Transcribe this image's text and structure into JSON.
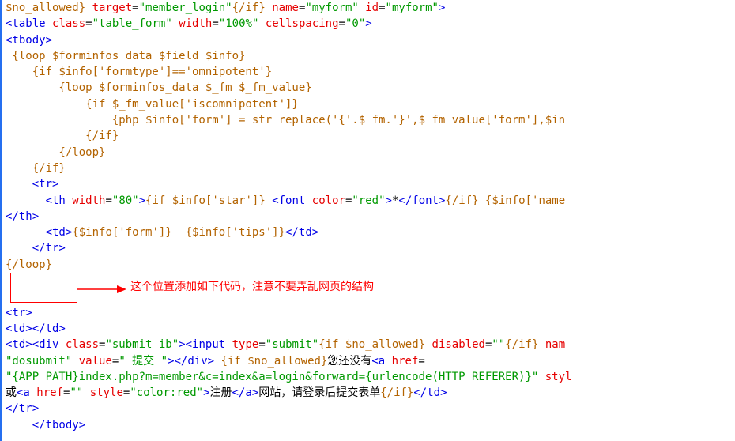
{
  "code_lines": [
    [
      {
        "c": "t-kw",
        "t": "$no_allowed}"
      },
      {
        "c": "t-text",
        "t": " "
      },
      {
        "c": "t-attr",
        "t": "target"
      },
      {
        "c": "t-eq",
        "t": "="
      },
      {
        "c": "t-str",
        "t": "\"member_login\""
      },
      {
        "c": "t-kw",
        "t": "{/if}"
      },
      {
        "c": "t-text",
        "t": " "
      },
      {
        "c": "t-attr",
        "t": "name"
      },
      {
        "c": "t-eq",
        "t": "="
      },
      {
        "c": "t-str",
        "t": "\"myform\""
      },
      {
        "c": "t-text",
        "t": " "
      },
      {
        "c": "t-attr",
        "t": "id"
      },
      {
        "c": "t-eq",
        "t": "="
      },
      {
        "c": "t-str",
        "t": "\"myform\""
      },
      {
        "c": "t-tag",
        "t": ">"
      }
    ],
    [
      {
        "c": "t-tag",
        "t": "<table "
      },
      {
        "c": "t-attr",
        "t": "class"
      },
      {
        "c": "t-eq",
        "t": "="
      },
      {
        "c": "t-str",
        "t": "\"table_form\""
      },
      {
        "c": "t-text",
        "t": " "
      },
      {
        "c": "t-attr",
        "t": "width"
      },
      {
        "c": "t-eq",
        "t": "="
      },
      {
        "c": "t-str",
        "t": "\"100%\""
      },
      {
        "c": "t-text",
        "t": " "
      },
      {
        "c": "t-attr",
        "t": "cellspacing"
      },
      {
        "c": "t-eq",
        "t": "="
      },
      {
        "c": "t-str",
        "t": "\"0\""
      },
      {
        "c": "t-tag",
        "t": ">"
      }
    ],
    [
      {
        "c": "t-tag",
        "t": "<tbody>"
      }
    ],
    [
      {
        "c": "t-kw",
        "t": " {loop $forminfos_data $field $info}"
      }
    ],
    [
      {
        "c": "t-kw",
        "t": "    {if $info['formtype']=='omnipotent'}"
      }
    ],
    [
      {
        "c": "t-kw",
        "t": "        {loop $forminfos_data $_fm $_fm_value}"
      }
    ],
    [
      {
        "c": "t-kw",
        "t": "            {if $_fm_value['iscomnipotent']}"
      }
    ],
    [
      {
        "c": "t-kw",
        "t": "                {php $info['form'] = str_replace('{'.$_fm.'}',$_fm_value['form'],$in"
      }
    ],
    [
      {
        "c": "t-kw",
        "t": "            {/if}"
      }
    ],
    [
      {
        "c": "t-kw",
        "t": "        {/loop}"
      }
    ],
    [
      {
        "c": "t-kw",
        "t": "    {/if}"
      }
    ],
    [
      {
        "c": "t-text",
        "t": "    "
      },
      {
        "c": "t-tag",
        "t": "<tr>"
      }
    ],
    [
      {
        "c": "t-text",
        "t": "      "
      },
      {
        "c": "t-tag",
        "t": "<th "
      },
      {
        "c": "t-attr",
        "t": "width"
      },
      {
        "c": "t-eq",
        "t": "="
      },
      {
        "c": "t-str",
        "t": "\"80\""
      },
      {
        "c": "t-tag",
        "t": ">"
      },
      {
        "c": "t-kw",
        "t": "{if $info['star']}"
      },
      {
        "c": "t-text",
        "t": " "
      },
      {
        "c": "t-tag",
        "t": "<font "
      },
      {
        "c": "t-attr",
        "t": "color"
      },
      {
        "c": "t-eq",
        "t": "="
      },
      {
        "c": "t-str",
        "t": "\"red\""
      },
      {
        "c": "t-tag",
        "t": ">"
      },
      {
        "c": "t-text",
        "t": "*"
      },
      {
        "c": "t-tag",
        "t": "</font>"
      },
      {
        "c": "t-kw",
        "t": "{/if}"
      },
      {
        "c": "t-text",
        "t": " "
      },
      {
        "c": "t-kw",
        "t": "{$info['name"
      }
    ],
    [
      {
        "c": "t-tag",
        "t": "</th>"
      }
    ],
    [
      {
        "c": "t-text",
        "t": "      "
      },
      {
        "c": "t-tag",
        "t": "<td>"
      },
      {
        "c": "t-kw",
        "t": "{$info['form']}"
      },
      {
        "c": "t-text",
        "t": "  "
      },
      {
        "c": "t-kw",
        "t": "{$info['tips']}"
      },
      {
        "c": "t-tag",
        "t": "</td>"
      }
    ],
    [
      {
        "c": "t-text",
        "t": "    "
      },
      {
        "c": "t-tag",
        "t": "</tr>"
      }
    ],
    [
      {
        "c": "t-kw",
        "t": "{/loop}"
      }
    ],
    [
      {
        "c": "t-text",
        "t": " "
      }
    ],
    [
      {
        "c": "t-text",
        "t": " "
      }
    ],
    [
      {
        "c": "t-tag",
        "t": "<tr>"
      }
    ],
    [
      {
        "c": "t-tag",
        "t": "<td></td>"
      }
    ],
    [
      {
        "c": "t-tag",
        "t": "<td><div "
      },
      {
        "c": "t-attr",
        "t": "class"
      },
      {
        "c": "t-eq",
        "t": "="
      },
      {
        "c": "t-str",
        "t": "\"submit ib\""
      },
      {
        "c": "t-tag",
        "t": ">"
      },
      {
        "c": "t-tag",
        "t": "<input "
      },
      {
        "c": "t-attr",
        "t": "type"
      },
      {
        "c": "t-eq",
        "t": "="
      },
      {
        "c": "t-str",
        "t": "\"submit\""
      },
      {
        "c": "t-kw",
        "t": "{if $no_allowed}"
      },
      {
        "c": "t-text",
        "t": " "
      },
      {
        "c": "t-attr",
        "t": "disabled"
      },
      {
        "c": "t-eq",
        "t": "="
      },
      {
        "c": "t-str",
        "t": "\"\""
      },
      {
        "c": "t-kw",
        "t": "{/if}"
      },
      {
        "c": "t-text",
        "t": " "
      },
      {
        "c": "t-attr",
        "t": "nam"
      }
    ],
    [
      {
        "c": "t-str",
        "t": "\"dosubmit\""
      },
      {
        "c": "t-text",
        "t": " "
      },
      {
        "c": "t-attr",
        "t": "value"
      },
      {
        "c": "t-eq",
        "t": "="
      },
      {
        "c": "t-str",
        "t": "\" 提交 \""
      },
      {
        "c": "t-tag",
        "t": "></div>"
      },
      {
        "c": "t-text",
        "t": " "
      },
      {
        "c": "t-kw",
        "t": "{if $no_allowed}"
      },
      {
        "c": "t-text",
        "t": "您还没有"
      },
      {
        "c": "t-tag",
        "t": "<a "
      },
      {
        "c": "t-attr",
        "t": "href"
      },
      {
        "c": "t-eq",
        "t": "="
      }
    ],
    [
      {
        "c": "t-str",
        "t": "\"{APP_PATH}index.php?m=member&c=index&a=login&forward={urlencode(HTTP_REFERER)}\""
      },
      {
        "c": "t-text",
        "t": " "
      },
      {
        "c": "t-attr",
        "t": "styl"
      }
    ],
    [
      {
        "c": "t-text",
        "t": "或"
      },
      {
        "c": "t-tag",
        "t": "<a "
      },
      {
        "c": "t-attr",
        "t": "href"
      },
      {
        "c": "t-eq",
        "t": "="
      },
      {
        "c": "t-str",
        "t": "\"\""
      },
      {
        "c": "t-text",
        "t": " "
      },
      {
        "c": "t-attr",
        "t": "style"
      },
      {
        "c": "t-eq",
        "t": "="
      },
      {
        "c": "t-str",
        "t": "\"color:red\""
      },
      {
        "c": "t-tag",
        "t": ">"
      },
      {
        "c": "t-text",
        "t": "注册"
      },
      {
        "c": "t-tag",
        "t": "</a>"
      },
      {
        "c": "t-text",
        "t": "网站，请登录后提交表单"
      },
      {
        "c": "t-kw",
        "t": "{/if}"
      },
      {
        "c": "t-tag",
        "t": "</td>"
      }
    ],
    [
      {
        "c": "t-tag",
        "t": "</tr>"
      }
    ],
    [
      {
        "c": "t-text",
        "t": "    "
      },
      {
        "c": "t-tag",
        "t": "</tbody>"
      }
    ]
  ],
  "annotation": {
    "text": "这个位置添加如下代码，注意不要弄乱网页的结构"
  }
}
